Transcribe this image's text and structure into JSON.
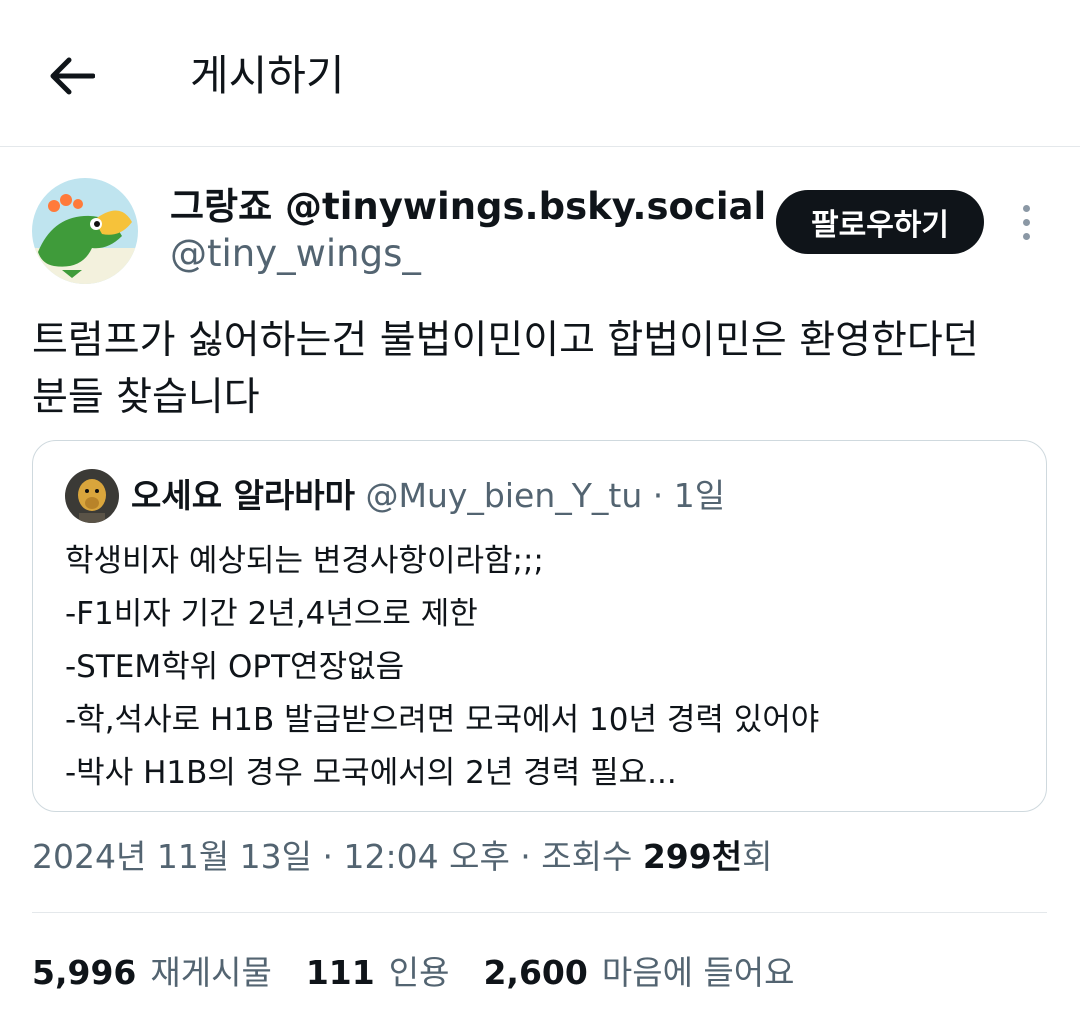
{
  "header": {
    "title": "게시하기",
    "back_icon": "arrow-left-icon"
  },
  "author": {
    "display_name": "그랑죠 @tinywings.bsky.social",
    "handle": "@tiny_wings_",
    "follow_label": "팔로우하기",
    "more_icon": "more-vertical-icon"
  },
  "post": {
    "lines": [
      "트럼프가 싫어하는건 불법이민이고 합법이민은 환영한다던",
      "분들 찾습니다"
    ]
  },
  "quote": {
    "name": "오세요 알라바마",
    "handle": "@Muy_bien_Y_tu",
    "time": " · 1일",
    "lines": [
      "학생비자 예상되는 변경사항이라함;;;",
      "-F1비자 기간 2년,4년으로 제한",
      "-STEM학위 OPT연장없음",
      "-학,석사로 H1B 발급받으려면 모국에서 10년 경력 있어야",
      "-박사 H1B의 경우 모국에서의 2년 경력 필요..."
    ]
  },
  "meta": {
    "date_time": "2024년 11월 13일 · 12:04 오후 · 조회수 ",
    "views_num": "299천",
    "views_suffix": "회"
  },
  "stats": {
    "reposts_count": "5,996",
    "reposts_label": "재게시물",
    "quotes_count": "111",
    "quotes_label": "인용",
    "likes_count": "2,600",
    "likes_label": "마음에 들어요"
  },
  "colors": {
    "text_primary": "#0f1419",
    "text_secondary": "#536471",
    "border": "#cfd9de",
    "button_bg": "#0f1419"
  }
}
